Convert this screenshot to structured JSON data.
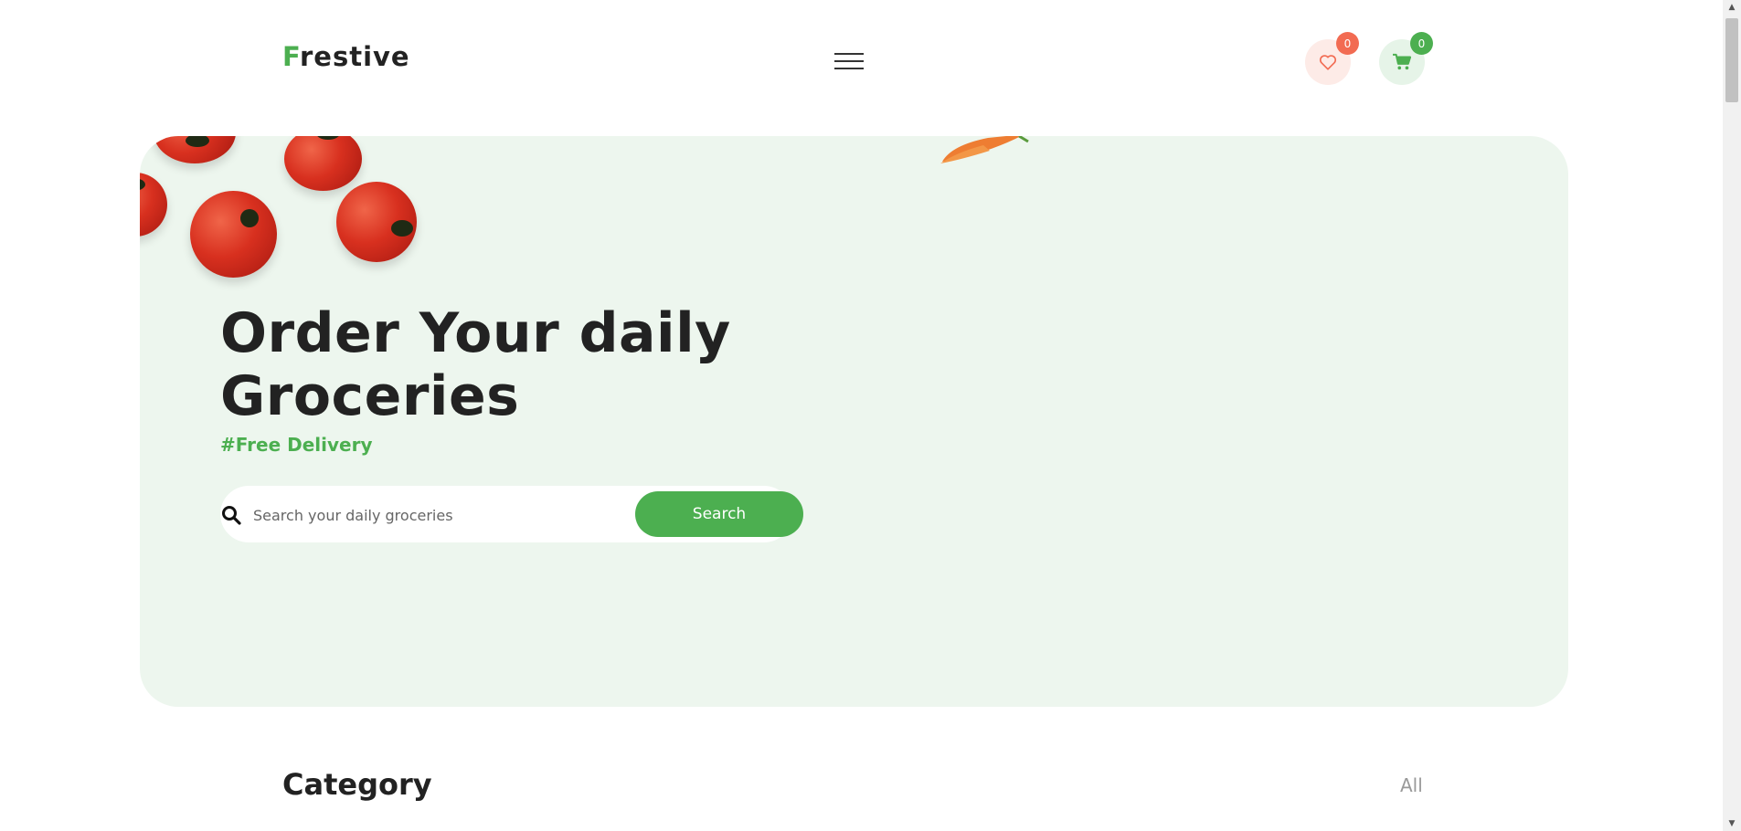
{
  "header": {
    "logo_first": "F",
    "logo_rest": "restive",
    "wishlist_count": "0",
    "cart_count": "0"
  },
  "hero": {
    "headline_line1": "Order Your daily",
    "headline_line2": "Groceries",
    "tagline": "#Free Delivery",
    "search_placeholder": "Search your daily groceries",
    "search_button": "Search"
  },
  "category": {
    "title": "Category",
    "all_link": "All"
  },
  "colors": {
    "brand_green": "#4caf50",
    "hero_bg": "#edf6ee",
    "wishlist_accent": "#f26b52"
  },
  "icons": {
    "menu": "hamburger-menu-icon",
    "wishlist": "heart-icon",
    "cart": "cart-icon",
    "search": "search-icon"
  }
}
